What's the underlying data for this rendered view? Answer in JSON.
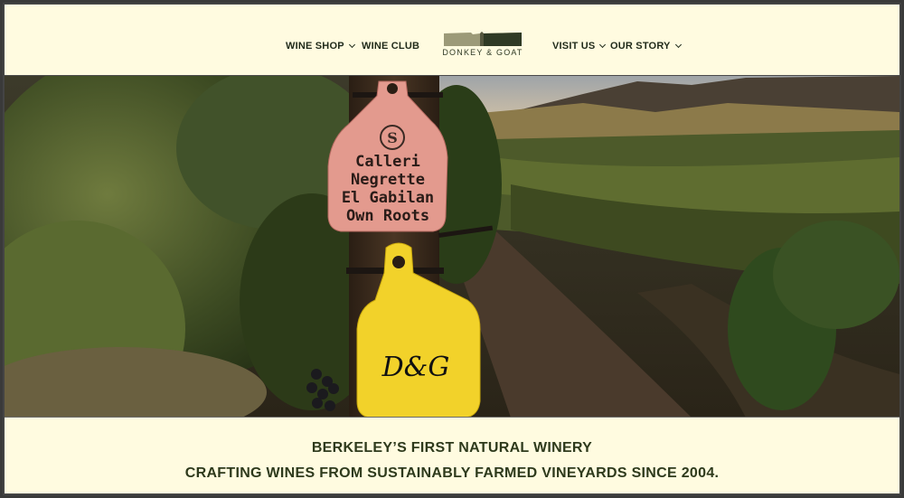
{
  "nav": {
    "items": [
      {
        "label": "WINE SHOP",
        "dropdown": true
      },
      {
        "label": "WINE CLUB",
        "dropdown": false
      },
      {
        "label": "VISIT US",
        "dropdown": true
      },
      {
        "label": "OUR STORY",
        "dropdown": true
      }
    ]
  },
  "logo": {
    "text": "DONKEY & GOAT",
    "icon": "donkey-goat-logo-icon"
  },
  "hero": {
    "tag_pink": {
      "line1": "Calleri",
      "line2": "Negrette",
      "line3": "El Gabilan",
      "line4": "Own Roots",
      "badge": "S"
    },
    "tag_yellow": {
      "text": "D&G"
    }
  },
  "tagline": {
    "line1": "BERKELEY’S FIRST NATURAL WINERY",
    "line2": "CRAFTING WINES FROM SUSTAINABLY FARMED VINEYARDS SINCE 2004."
  },
  "colors": {
    "background": "#fffbe0",
    "text": "#2e3a1c",
    "pink_tag": "#e39a8e",
    "yellow_tag": "#f2d22a"
  }
}
